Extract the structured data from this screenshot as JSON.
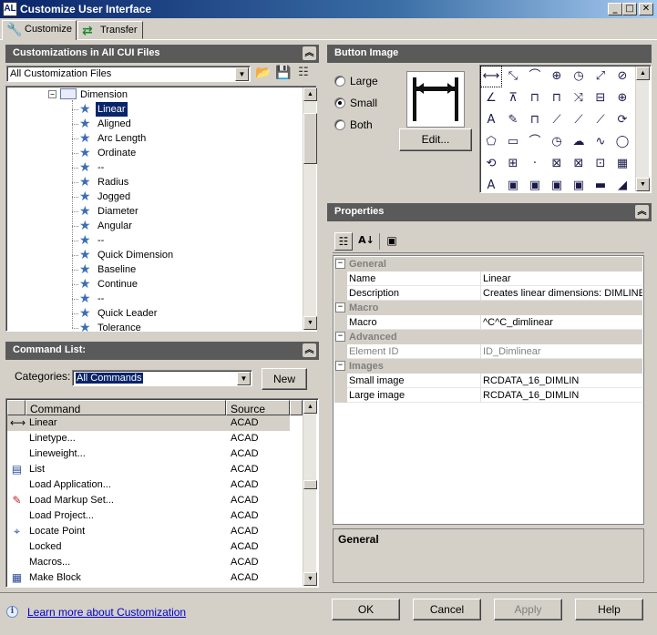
{
  "window": {
    "title": "Customize User Interface",
    "app_icon": "AL"
  },
  "tabs": [
    {
      "label": "Customize",
      "icon": "wrench-icon"
    },
    {
      "label": "Transfer",
      "icon": "transfer-arrows-icon"
    }
  ],
  "customizations": {
    "header": "Customizations in All CUI Files",
    "filter_value": "All Customization Files",
    "tree_parent": "Dimension",
    "tree_items": [
      "Linear",
      "Aligned",
      "Arc Length",
      "Ordinate",
      "--",
      "Radius",
      "Jogged",
      "Diameter",
      "Angular",
      "--",
      "Quick Dimension",
      "Baseline",
      "Continue",
      "--",
      "Quick Leader",
      "Tolerance"
    ],
    "selected_item": "Linear"
  },
  "command_list": {
    "header": "Command List:",
    "categories_label": "Categories:",
    "categories_value": "All Commands",
    "new_label": "New",
    "columns": [
      "Command",
      "Source"
    ],
    "rows": [
      {
        "name": "Linear",
        "source": "ACAD",
        "icon": "linear-dim-icon",
        "selected": true
      },
      {
        "name": "Linetype...",
        "source": "ACAD",
        "icon": ""
      },
      {
        "name": "Lineweight...",
        "source": "ACAD",
        "icon": ""
      },
      {
        "name": "List",
        "source": "ACAD",
        "icon": "list-icon"
      },
      {
        "name": "Load Application...",
        "source": "ACAD",
        "icon": ""
      },
      {
        "name": "Load Markup Set...",
        "source": "ACAD",
        "icon": "markup-icon"
      },
      {
        "name": "Load Project...",
        "source": "ACAD",
        "icon": ""
      },
      {
        "name": "Locate Point",
        "source": "ACAD",
        "icon": "locate-point-icon"
      },
      {
        "name": "Locked",
        "source": "ACAD",
        "icon": ""
      },
      {
        "name": "Macros...",
        "source": "ACAD",
        "icon": ""
      },
      {
        "name": "Make Block",
        "source": "ACAD",
        "icon": "make-block-icon"
      }
    ]
  },
  "button_image": {
    "header": "Button Image",
    "options": [
      "Large",
      "Small",
      "Both"
    ],
    "selected_option": "Small",
    "edit_label": "Edit..."
  },
  "properties": {
    "header": "Properties",
    "sections": [
      {
        "name": "General",
        "rows": [
          {
            "key": "Name",
            "value": "Linear"
          },
          {
            "key": "Description",
            "value": "Creates linear dimensions:  DIMLINEAR"
          }
        ]
      },
      {
        "name": "Macro",
        "rows": [
          {
            "key": "Macro",
            "value": "^C^C_dimlinear"
          }
        ]
      },
      {
        "name": "Advanced",
        "rows": [
          {
            "key": "Element ID",
            "value": "ID_Dimlinear",
            "disabled": true
          }
        ]
      },
      {
        "name": "Images",
        "rows": [
          {
            "key": "Small image",
            "value": "RCDATA_16_DIMLIN"
          },
          {
            "key": "Large image",
            "value": "RCDATA_16_DIMLIN"
          }
        ]
      }
    ],
    "help_title": "General"
  },
  "footer": {
    "learn_more": "Learn more about Customization",
    "ok": "OK",
    "cancel": "Cancel",
    "apply": "Apply",
    "help": "Help"
  }
}
